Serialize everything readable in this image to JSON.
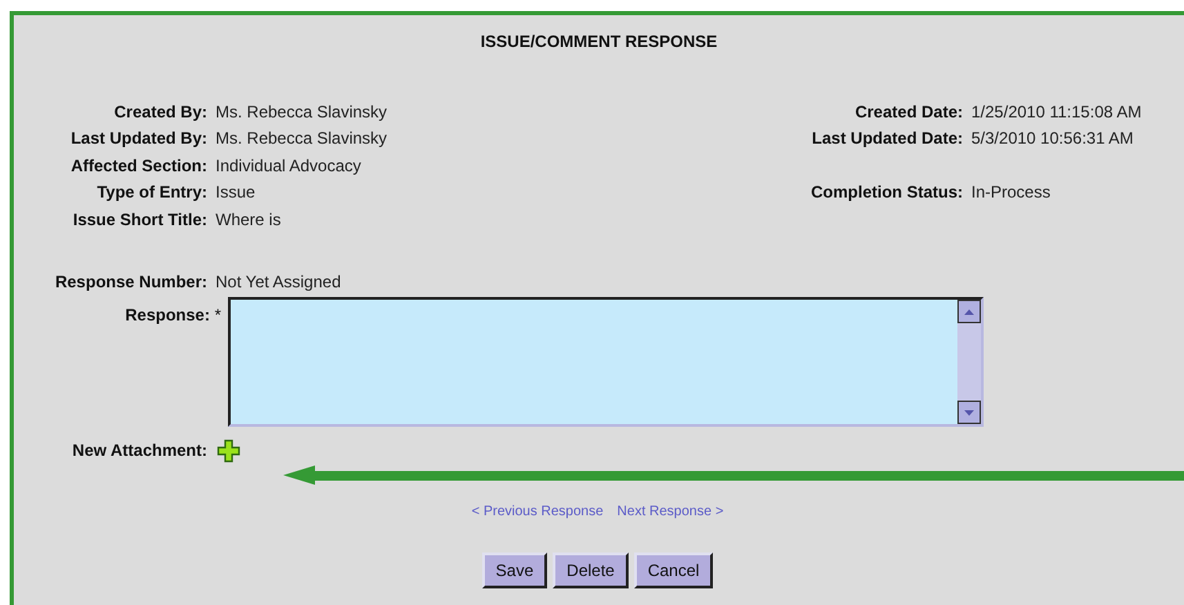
{
  "title": "ISSUE/COMMENT RESPONSE",
  "left_fields": [
    {
      "label": "Created By:",
      "value": "Ms. Rebecca Slavinsky"
    },
    {
      "label": "Last Updated By:",
      "value": "Ms. Rebecca Slavinsky"
    },
    {
      "label": "Affected Section:",
      "value": "Individual Advocacy"
    },
    {
      "label": "Type of Entry:",
      "value": "Issue"
    },
    {
      "label": "Issue Short Title:",
      "value": "Where is"
    }
  ],
  "right_fields": [
    {
      "label": "Created Date:",
      "value": "1/25/2010 11:15:08 AM"
    },
    {
      "label": "Last Updated Date:",
      "value": "5/3/2010 10:56:31 AM"
    }
  ],
  "completion_status": {
    "label": "Completion Status:",
    "value": "In-Process"
  },
  "response_number": {
    "label": "Response Number:",
    "value": "Not Yet Assigned"
  },
  "response": {
    "label": "Response:",
    "required_mark": "*"
  },
  "new_attachment": {
    "label": "New Attachment:"
  },
  "links": [
    "< Previous Response",
    "Next Response >"
  ],
  "buttons": [
    "Save",
    "Delete",
    "Cancel"
  ]
}
